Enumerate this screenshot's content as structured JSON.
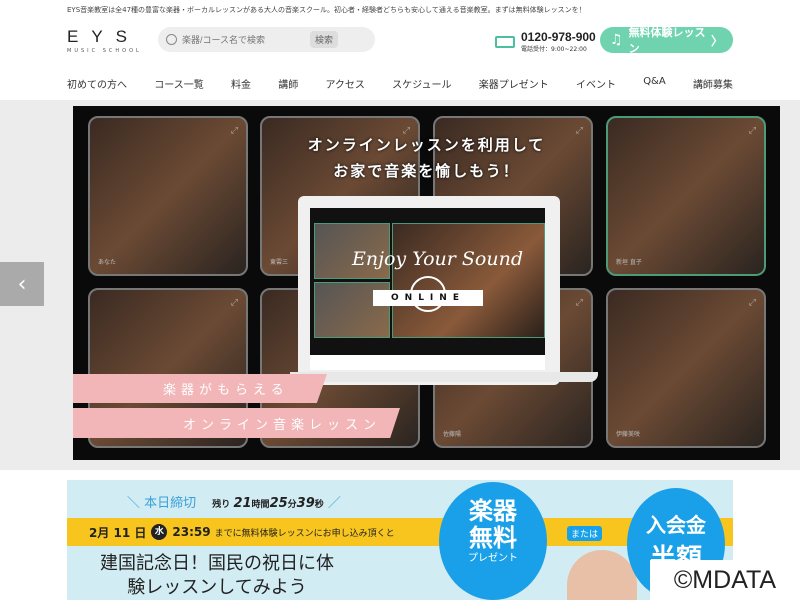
{
  "header": {
    "tagline": "EYS音楽教室は全47種の豊富な楽器・ボーカルレッスンがある大人の音楽スクール。初心者・経験者どちらも安心して通える音楽教室。まずは無料体験レッスンを！",
    "logo_main": "EYS",
    "logo_sub": "MUSIC SCHOOL",
    "search_placeholder": "楽器/コース名で検索",
    "search_button": "検索",
    "phone": "0120-978-900",
    "phone_hours": "電話受付：9:00~22:00",
    "cta": "無料体験レッスン"
  },
  "nav": [
    "初めての方へ",
    "コース一覧",
    "料金",
    "講師",
    "アクセス",
    "スケジュール",
    "楽器プレゼント",
    "イベント",
    "Q&A",
    "講師募集"
  ],
  "banner": {
    "headline1": "オンラインレッスンを利用して",
    "headline2": "お家で音楽を愉しもう！",
    "enjoy": "Enjoy Your Sound",
    "online": "ONLINE",
    "pink1": "楽器がもらえる",
    "pink2": "オンライン音楽レッスン",
    "tile_names": [
      "あなた",
      "東雲三",
      "",
      "新垣 直子",
      "",
      "",
      "佐藤陽",
      "伊藤美咲"
    ]
  },
  "promo": {
    "deadline": "本日締切",
    "remaining_label": "残り",
    "hours": "21",
    "hours_unit": "時間",
    "minutes": "25",
    "minutes_unit": "分",
    "seconds": "39",
    "seconds_unit": "秒",
    "date": "2月 11 日",
    "weekday": "水",
    "time": "23:59",
    "date_tail": "までに無料体験レッスンにお申し込み頂くと",
    "main_copy": "建国記念日！国民の祝日に体験レッスンしてみよう",
    "circle1_line1": "楽器",
    "circle1_line2": "無料",
    "circle1_sub": "プレゼント",
    "or": "または",
    "circle2_line1": "入会金",
    "circle2_line2": "半額"
  },
  "watermark": "©MDATA"
}
